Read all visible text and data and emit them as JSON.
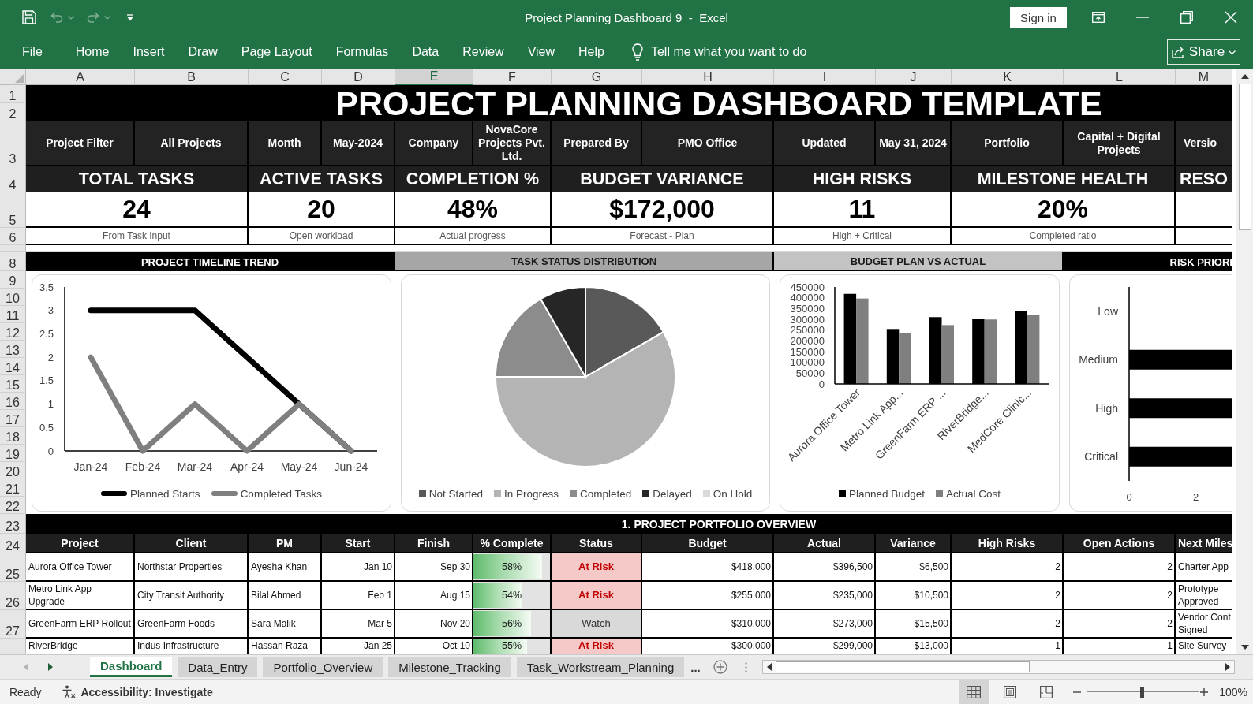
{
  "window": {
    "title": "Project Planning Dashboard 9  -  Excel",
    "sign_in": "Sign in"
  },
  "quick_access": {
    "undo": {
      "disabled": true
    },
    "redo": {
      "disabled": true
    }
  },
  "ribbon": {
    "tabs": [
      "File",
      "Home",
      "Insert",
      "Draw",
      "Page Layout",
      "Formulas",
      "Data",
      "Review",
      "View",
      "Help"
    ],
    "tell_me": "Tell me what you want to do",
    "share": "Share"
  },
  "columns": [
    {
      "label": "A",
      "selected": false
    },
    {
      "label": "B",
      "selected": false
    },
    {
      "label": "C",
      "selected": false
    },
    {
      "label": "D",
      "selected": false
    },
    {
      "label": "E",
      "selected": true
    },
    {
      "label": "F",
      "selected": false
    },
    {
      "label": "G",
      "selected": false
    },
    {
      "label": "H",
      "selected": false
    },
    {
      "label": "I",
      "selected": false
    },
    {
      "label": "J",
      "selected": false
    },
    {
      "label": "K",
      "selected": false
    },
    {
      "label": "L",
      "selected": false
    },
    {
      "label": "M",
      "selected": false
    }
  ],
  "title_block": {
    "rows": [
      "1",
      "2"
    ],
    "text": "PROJECT PLANNING DASHBOARD TEMPLATE"
  },
  "info_row": {
    "row": "3",
    "cells": [
      "Project Filter",
      "All Projects",
      "Month",
      "May-2024",
      "Company",
      "NovaCore Projects Pvt. Ltd.",
      "Prepared By",
      "PMO Office",
      "Updated",
      "May 31, 2024",
      "Portfolio",
      "Capital + Digital Projects",
      "Versio"
    ]
  },
  "kpis": {
    "rows": [
      "4",
      "5",
      "6"
    ],
    "items": [
      {
        "label": "TOTAL TASKS",
        "value": "24",
        "caption": "From Task Input"
      },
      {
        "label": "ACTIVE TASKS",
        "value": "20",
        "caption": "Open workload"
      },
      {
        "label": "COMPLETION %",
        "value": "48%",
        "caption": "Actual progress"
      },
      {
        "label": "BUDGET VARIANCE",
        "value": "$172,000",
        "caption": "Forecast - Plan"
      },
      {
        "label": "HIGH RISKS",
        "value": "11",
        "caption": "High + Critical"
      },
      {
        "label": "MILESTONE HEALTH",
        "value": "20%",
        "caption": "Completed ratio"
      },
      {
        "label": "RESO"
      }
    ]
  },
  "charts": {
    "rows": [
      "8",
      "9",
      "10",
      "11",
      "12",
      "13",
      "14",
      "15",
      "16",
      "17",
      "18",
      "19",
      "20",
      "21",
      "22"
    ],
    "panels": [
      {
        "title": "PROJECT TIMELINE TREND",
        "kind": "dark",
        "chart_data": {
          "type": "line",
          "categories": [
            "Jan-24",
            "Feb-24",
            "Mar-24",
            "Apr-24",
            "May-24",
            "Jun-24"
          ],
          "series": [
            {
              "name": "Planned Starts",
              "color": "#000000",
              "values": [
                3,
                3,
                3,
                2,
                1,
                0
              ]
            },
            {
              "name": "Completed Tasks",
              "color": "#7f7f7f",
              "values": [
                2,
                0,
                1,
                0,
                1,
                0
              ]
            }
          ],
          "ylim": [
            0,
            3.5
          ],
          "yticks": [
            0,
            0.5,
            1,
            1.5,
            2,
            2.5,
            3,
            3.5
          ],
          "legend": "bottom"
        }
      },
      {
        "title": "TASK STATUS DISTRIBUTION",
        "kind": "gray",
        "chart_data": {
          "type": "pie",
          "categories": [
            "Not Started",
            "In Progress",
            "Completed",
            "Delayed",
            "On Hold"
          ],
          "values": [
            16.7,
            58.3,
            16.7,
            8.3,
            0
          ],
          "legend": "bottom"
        }
      },
      {
        "title": "BUDGET PLAN VS ACTUAL",
        "kind": "light",
        "chart_data": {
          "type": "bar",
          "categories": [
            "Aurora Office Tower",
            "Metro Link App...",
            "GreenFarm ERP ...",
            "RiverBridge...",
            "MedCore Clinic..."
          ],
          "series": [
            {
              "name": "Planned Budget",
              "color": "#000000",
              "values": [
                418000,
                255000,
                310000,
                300000,
                340000
              ]
            },
            {
              "name": "Actual Cost",
              "color": "#7f7f7f",
              "values": [
                396500,
                235000,
                273000,
                299000,
                322000
              ]
            }
          ],
          "ylim": [
            0,
            450000
          ],
          "yticks": [
            0,
            50000,
            100000,
            150000,
            200000,
            250000,
            300000,
            350000,
            400000,
            450000
          ],
          "legend": "bottom"
        }
      },
      {
        "title": "RISK PRIORI",
        "kind": "dark",
        "chart_data": {
          "type": "bar",
          "orientation": "horizontal",
          "categories": [
            "Low",
            "Medium",
            "High",
            "Critical"
          ],
          "values": [
            0,
            3.1,
            3.1,
            3.1
          ],
          "xlim": [
            0,
            3.1
          ],
          "xticks": [
            0,
            2
          ]
        }
      }
    ]
  },
  "portfolio": {
    "title_row": "23",
    "title": "1. PROJECT PORTFOLIO OVERVIEW",
    "header_row": "24",
    "columns": [
      "Project",
      "Client",
      "PM",
      "Start",
      "Finish",
      "% Complete",
      "Status",
      "Budget",
      "Actual",
      "Variance",
      "High Risks",
      "Open Actions",
      "Next Miles"
    ],
    "rows": [
      {
        "row": "25",
        "project": "Aurora Office Tower",
        "client": "Northstar Properties",
        "pm": "Ayesha Khan",
        "start": "Jan 10",
        "finish": "Sep 30",
        "complete": {
          "text": "58%",
          "level": 0.9
        },
        "status": {
          "text": "At Risk",
          "kind": "risk"
        },
        "budget": "$418,000",
        "actual": "$396,500",
        "variance": "$6,500",
        "high_risks": "2",
        "open_actions": "2",
        "column_13": "Charter App"
      },
      {
        "row": "26",
        "project": "Metro Link App\nUpgrade",
        "client": "City Transit Authority",
        "pm": "Bilal Ahmed",
        "start": "Feb 1",
        "finish": "Aug 15",
        "complete": {
          "text": "54%",
          "level": 0.64
        },
        "status": {
          "text": "At Risk",
          "kind": "risk"
        },
        "budget": "$255,000",
        "actual": "$235,000",
        "variance": "$10,500",
        "high_risks": "2",
        "open_actions": "2",
        "column_13": "Prototype\nApproved"
      },
      {
        "row": "27",
        "project": "GreenFarm ERP Rollout",
        "client": "GreenFarm Foods",
        "pm": "Sara Malik",
        "start": "Mar 5",
        "finish": "Nov 20",
        "complete": {
          "text": "56%",
          "level": 0.75
        },
        "status": {
          "text": "Watch",
          "kind": "watch"
        },
        "budget": "$310,000",
        "actual": "$273,000",
        "variance": "$15,500",
        "high_risks": "2",
        "open_actions": "2",
        "column_13": "Vendor Cont\nSigned"
      },
      {
        "project": "RiverBridge",
        "client": "Indus Infrastructure",
        "pm": "Hassan Raza",
        "start": "Jan 25",
        "finish": "Oct 10",
        "complete": {
          "text": "55%",
          "level": 0.7
        },
        "status": {
          "text": "At Risk",
          "kind": "risk"
        },
        "budget": "$300,000",
        "actual": "$299,000",
        "variance": "$13,000",
        "high_risks": "1",
        "open_actions": "1",
        "column_13": "Site Survey"
      }
    ]
  },
  "sheet_tabs": {
    "tabs": [
      {
        "label": "Dashboard",
        "selected": true
      },
      {
        "label": "Data_Entry",
        "selected": false
      },
      {
        "label": "Portfolio_Overview",
        "selected": false
      },
      {
        "label": "Milestone_Tracking",
        "selected": false
      },
      {
        "label": "Task_Workstream_Planning",
        "selected": false
      }
    ],
    "more": "..."
  },
  "status_bar": {
    "status": "Ready",
    "accessibility": "Accessibility: Investigate",
    "views": [
      {
        "kind": "normal",
        "selected": true
      },
      {
        "kind": "page_layout",
        "selected": false
      },
      {
        "kind": "page_break",
        "selected": false
      }
    ],
    "zoom": {
      "level": 0.49,
      "reading": "100%"
    }
  }
}
